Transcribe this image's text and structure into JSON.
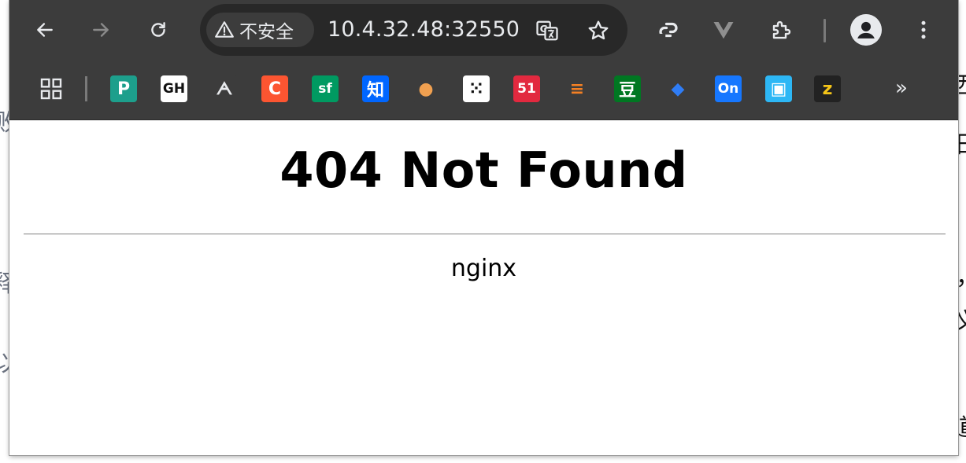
{
  "browser": {
    "nav": {
      "back": "back-arrow-icon",
      "forward": "forward-arrow-icon",
      "reload": "reload-icon"
    },
    "omnibox": {
      "security_label": "不安全",
      "url": "10.4.32.48:32550"
    },
    "colors": {
      "toolbar_bg": "#3c3c3c",
      "omnibox_bg": "#282828",
      "icon": "#e8eaed"
    },
    "bookmarks": [
      {
        "name": "bookmark-processon",
        "glyph": "P",
        "bg": "#1d9f8c"
      },
      {
        "name": "bookmark-github",
        "glyph": "GH",
        "bg": "#ffffff"
      },
      {
        "name": "bookmark-yuque",
        "glyph": "ᗅ",
        "bg": "#3c3c3c"
      },
      {
        "name": "bookmark-csdn",
        "glyph": "C",
        "bg": "#fc5531"
      },
      {
        "name": "bookmark-segmentfault",
        "glyph": "sf",
        "bg": "#009a61"
      },
      {
        "name": "bookmark-zhihu",
        "glyph": "知",
        "bg": "#0066ff"
      },
      {
        "name": "bookmark-egg",
        "glyph": "●",
        "bg": "#3c3c3c"
      },
      {
        "name": "bookmark-grid",
        "glyph": "⁙",
        "bg": "#ffffff"
      },
      {
        "name": "bookmark-51cto",
        "glyph": "51",
        "bg": "#e2293f"
      },
      {
        "name": "bookmark-stackoverflow",
        "glyph": "≡",
        "bg": "#3c3c3c"
      },
      {
        "name": "bookmark-douban",
        "glyph": "豆",
        "bg": "#007722"
      },
      {
        "name": "bookmark-box",
        "glyph": "◆",
        "bg": "#3c3c3c"
      },
      {
        "name": "bookmark-on",
        "glyph": "On",
        "bg": "#1677ff"
      },
      {
        "name": "bookmark-portrait",
        "glyph": "▣",
        "bg": "#2db7f5"
      },
      {
        "name": "bookmark-z",
        "glyph": "z",
        "bg": "#222222"
      }
    ]
  },
  "page": {
    "title": "404 Not Found",
    "server": "nginx"
  }
}
